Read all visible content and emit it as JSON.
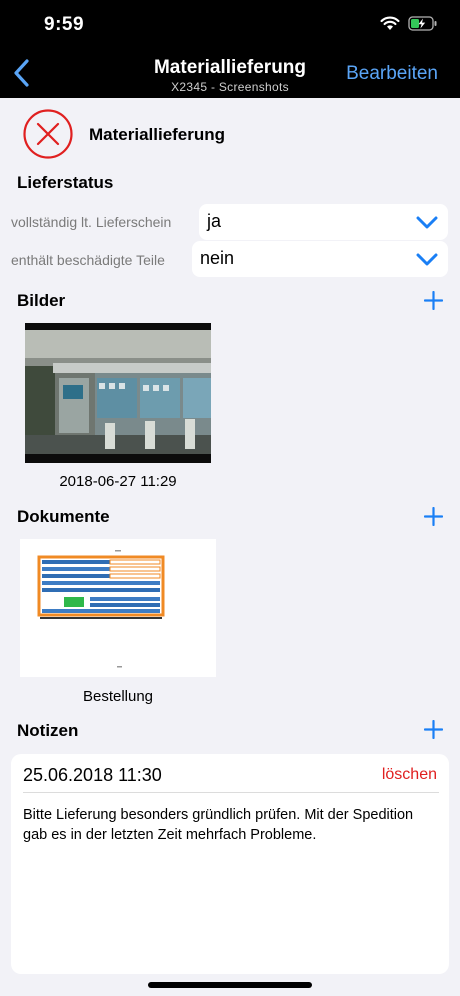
{
  "status_bar": {
    "time": "9:59"
  },
  "nav": {
    "title": "Materiallieferung",
    "subtitle": "X2345 - Screenshots",
    "edit_label": "Bearbeiten"
  },
  "delivery": {
    "title": "Materiallieferung"
  },
  "lieferstatus": {
    "heading": "Lieferstatus",
    "fields": [
      {
        "label": "vollständig lt. Lieferschein",
        "value": "ja"
      },
      {
        "label": "enthält beschädigte Teile",
        "value": "nein"
      }
    ]
  },
  "bilder": {
    "heading": "Bilder",
    "items": [
      {
        "caption": "2018-06-27 11:29"
      }
    ]
  },
  "dokumente": {
    "heading": "Dokumente",
    "items": [
      {
        "caption": "Bestellung"
      }
    ]
  },
  "notizen": {
    "heading": "Notizen",
    "items": [
      {
        "date": "25.06.2018 11:30",
        "delete_label": "löschen",
        "text": "Bitte Lieferung besonders gründlich prüfen. Mit der Spedition gab es in der letzten Zeit mehrfach Probleme."
      }
    ]
  },
  "colors": {
    "accent": "#1a7ff5",
    "nav_link": "#5aa5f7",
    "danger": "#e02020"
  }
}
